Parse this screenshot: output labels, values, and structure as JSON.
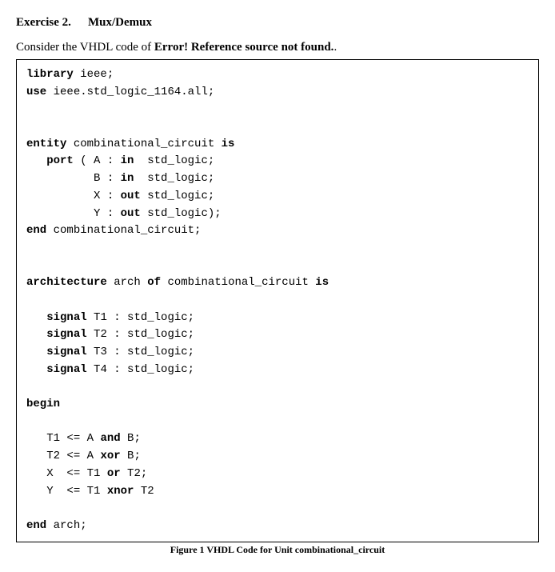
{
  "heading": {
    "exercise": "Exercise 2.",
    "title": "Mux/Demux"
  },
  "intro": {
    "prefix": "Consider the VHDL code of ",
    "bold": "Error! Reference source not found.",
    "suffix": "."
  },
  "code": {
    "kw": {
      "library": "library",
      "use": "use",
      "entity": "entity",
      "is": "is",
      "port": "port",
      "in": "in",
      "out": "out",
      "end": "end",
      "architecture": "architecture",
      "of": "of",
      "signal": "signal",
      "begin": "begin",
      "and": "and",
      "xor": "xor",
      "or": "or",
      "xnor": "xnor"
    },
    "lines": {
      "l1a": " ieee;",
      "l2a": " ieee.std_logic_1164.all;",
      "l3a": " combinational_circuit ",
      "l4a": " ( A : ",
      "l4b": "  std_logic;",
      "l5a": "B : ",
      "l5b": "  std_logic;",
      "l6a": "X : ",
      "l6b": " std_logic;",
      "l7a": "Y : ",
      "l7b": " std_logic);",
      "l8a": " combinational_circuit;",
      "l9a": " arch ",
      "l9b": " combinational_circuit ",
      "sig1": " T1 : std_logic;",
      "sig2": " T2 : std_logic;",
      "sig3": " T3 : std_logic;",
      "sig4": " T4 : std_logic;",
      "b1a": "T1 <= A ",
      "b1b": " B;",
      "b2a": "T2 <= A ",
      "b2b": " B;",
      "b3a": "X  <= T1 ",
      "b3b": " T2;",
      "b4a": "Y  <= T1 ",
      "b4b": " T2",
      "endarch": " arch;"
    }
  },
  "figure_caption": "Figure 1 VHDL Code for Unit combinational_circuit"
}
